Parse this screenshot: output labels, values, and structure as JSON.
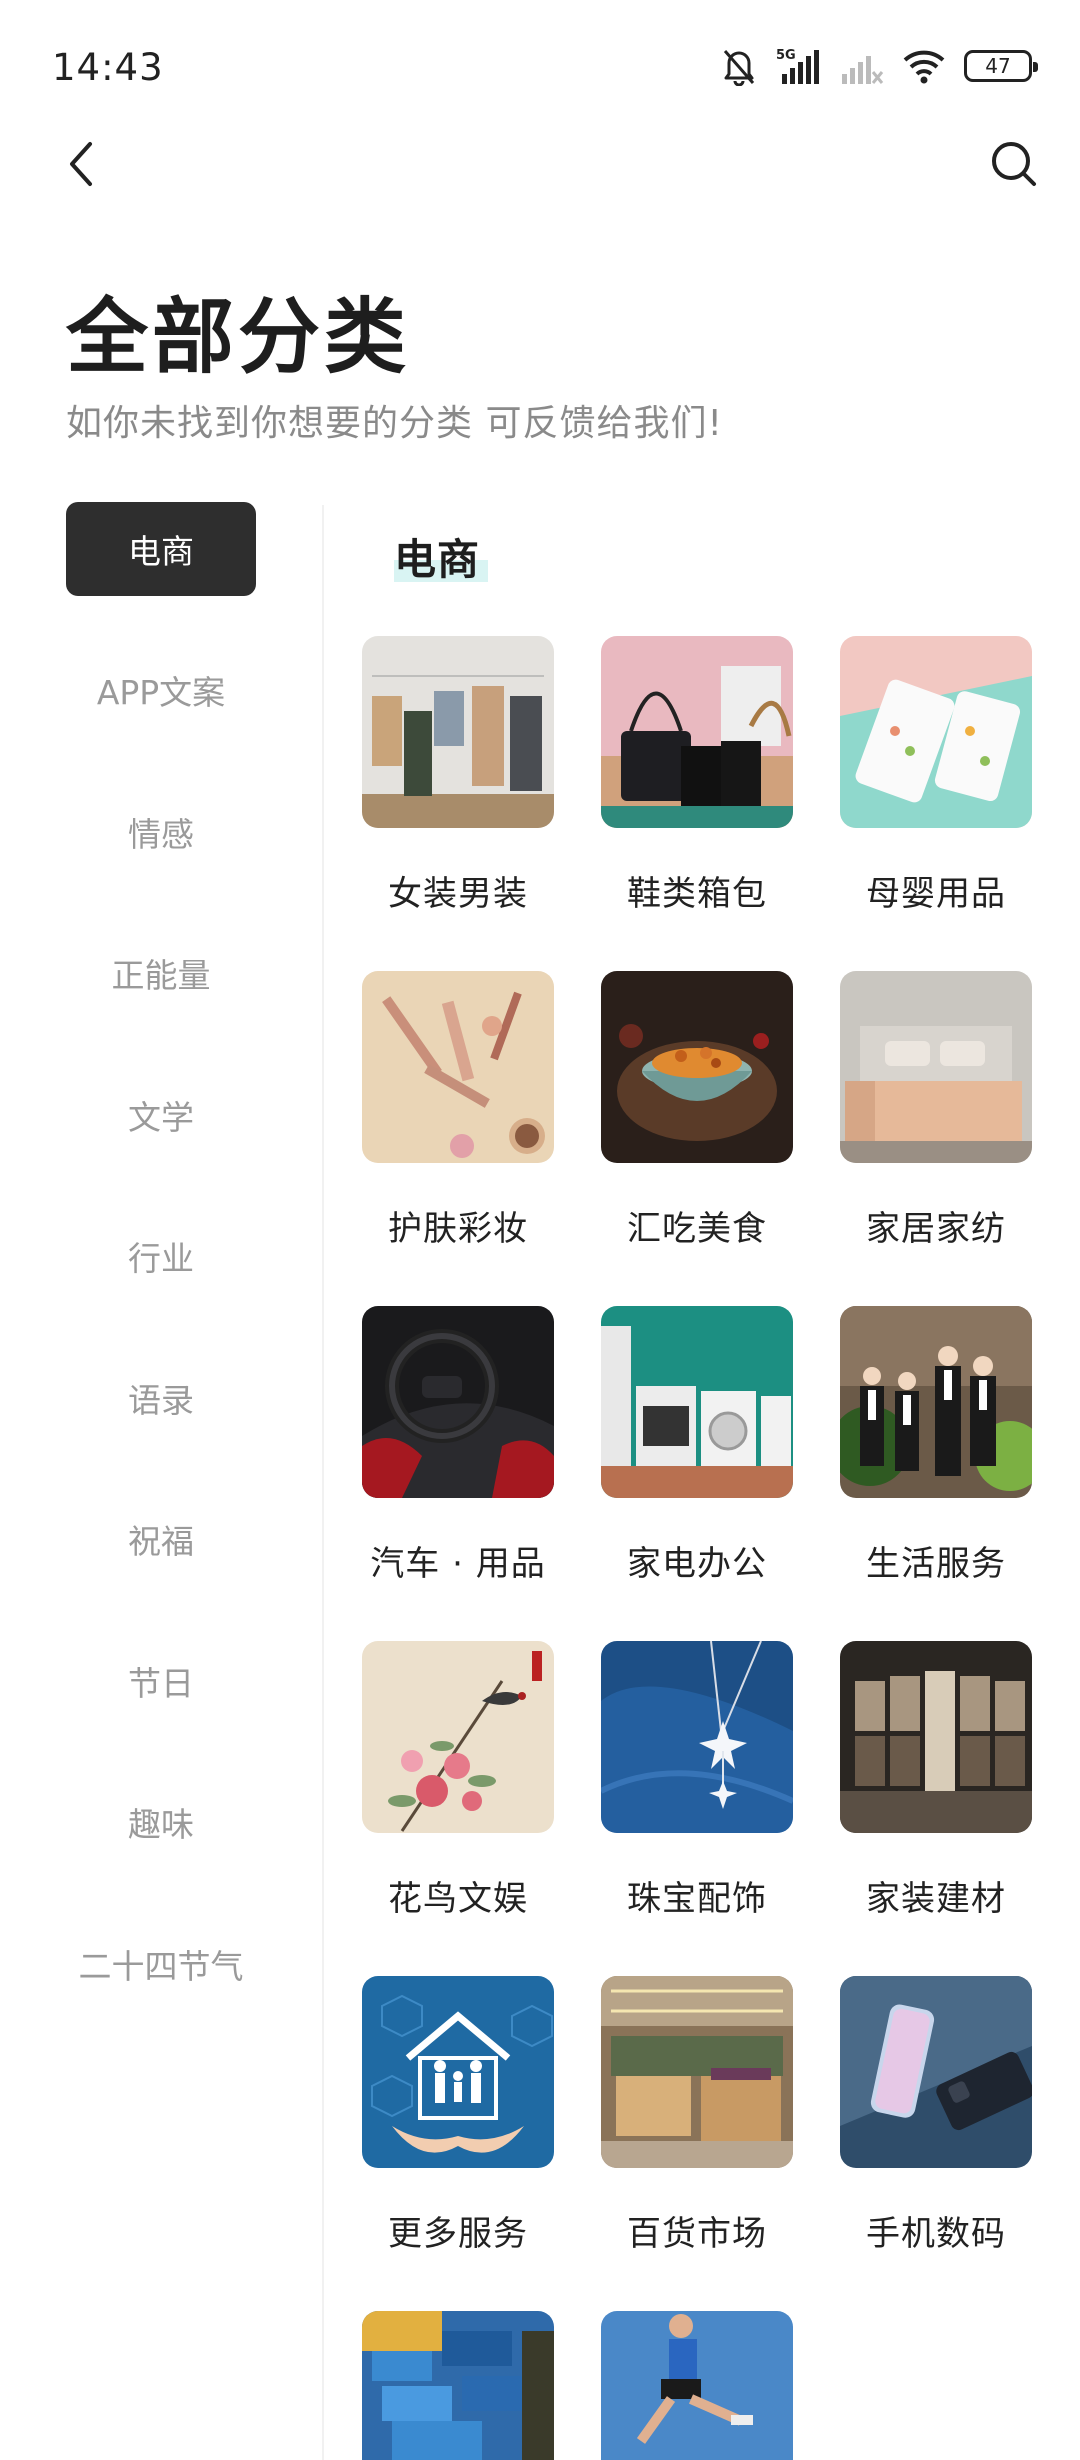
{
  "status": {
    "time": "14:43",
    "network": "5G",
    "battery": "47"
  },
  "header": {
    "title": "全部分类",
    "subtitle": "如你未找到你想要的分类 可反馈给我们!"
  },
  "sidebar": {
    "items": [
      {
        "label": "电商",
        "active": true
      },
      {
        "label": "APP文案"
      },
      {
        "label": "情感"
      },
      {
        "label": "正能量"
      },
      {
        "label": "文学"
      },
      {
        "label": "行业"
      },
      {
        "label": "语录"
      },
      {
        "label": "祝福"
      },
      {
        "label": "节日"
      },
      {
        "label": "趣味"
      },
      {
        "label": "二十四节气"
      }
    ]
  },
  "main": {
    "section_title": "电商",
    "categories": [
      {
        "label": "女装男装"
      },
      {
        "label": "鞋类箱包"
      },
      {
        "label": "母婴用品"
      },
      {
        "label": "护肤彩妆"
      },
      {
        "label": "汇吃美食"
      },
      {
        "label": "家居家纺"
      },
      {
        "label": "汽车 · 用品"
      },
      {
        "label": "家电办公"
      },
      {
        "label": "生活服务"
      },
      {
        "label": "花鸟文娱"
      },
      {
        "label": "珠宝配饰"
      },
      {
        "label": "家装建材"
      },
      {
        "label": "更多服务"
      },
      {
        "label": "百货市场"
      },
      {
        "label": "手机数码"
      },
      {
        "label": ""
      },
      {
        "label": ""
      }
    ]
  },
  "icons": {
    "back": "chevron-left-icon",
    "search": "search-icon"
  },
  "colors": {
    "active_bg": "#2e2e2e",
    "highlight": "#d9f4f3",
    "muted_text": "#9a9a9a"
  }
}
